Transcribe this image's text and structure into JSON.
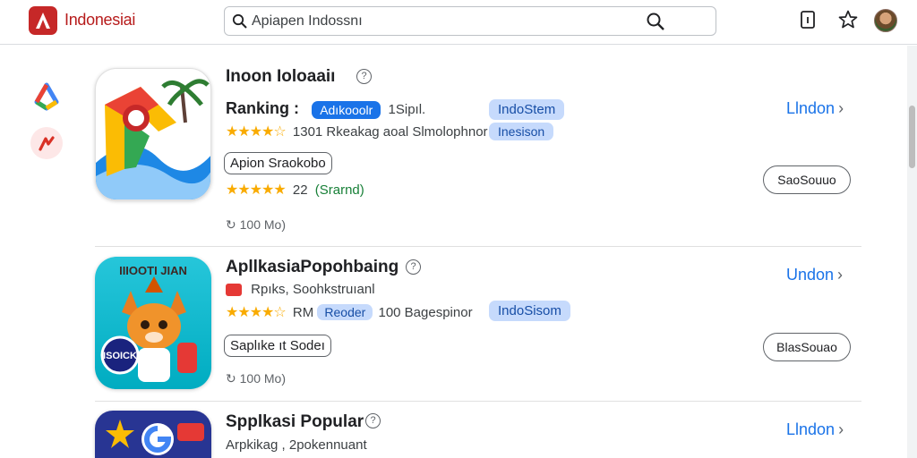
{
  "header": {
    "brand": "Indonesiai",
    "search_value": "Apiapen Indossnı",
    "icons": [
      "search-icon",
      "info-icon",
      "star-icon",
      "avatar"
    ]
  },
  "rail": {
    "icons": [
      "colorful-app-icon",
      "brand-mark-icon"
    ]
  },
  "cards": [
    {
      "title": "Inoon Ioloaaiı",
      "ranking_label": "Ranking :",
      "ranking_chip": "Adıkooolr",
      "ranking_text": "1Sipıl.",
      "tag_chip": "IndoStem",
      "rating_text": "1301 Rkeakag aoal Slmolophnor",
      "tag_chip_2": "Inesison",
      "category_pill": "Apion Sraokobo",
      "rating_text_2": "22",
      "rating_green": "(Srarnd)",
      "downloads": "100 Mo)",
      "link": "Llndon",
      "action": "SaoSouuo"
    },
    {
      "title": "ApllkasiaPopohbaing",
      "dev_text": "Rpıks, Soohkstruıanl",
      "rating_prefix": "RM",
      "rating_chip": "Reoder",
      "rating_text": "100 Bagespinor",
      "tag_chip": "IndoSisom",
      "category_pill": "Saplıke ıt Sodeı",
      "downloads": "100 Mo)",
      "link": "Undon",
      "action": "BlasSouao",
      "icon_banner": "IIIOOTI JIAN",
      "icon_badge": "ISOICK"
    },
    {
      "title": "Spplkasi Popular",
      "dev_text": "Arpkikag , 2pokennuant",
      "link": "Llndon"
    }
  ],
  "colors": {
    "brand_red": "#b71c1c",
    "link_blue": "#1a73e8",
    "chip_light": "#c6dafc",
    "star_gold": "#f9ab00"
  }
}
